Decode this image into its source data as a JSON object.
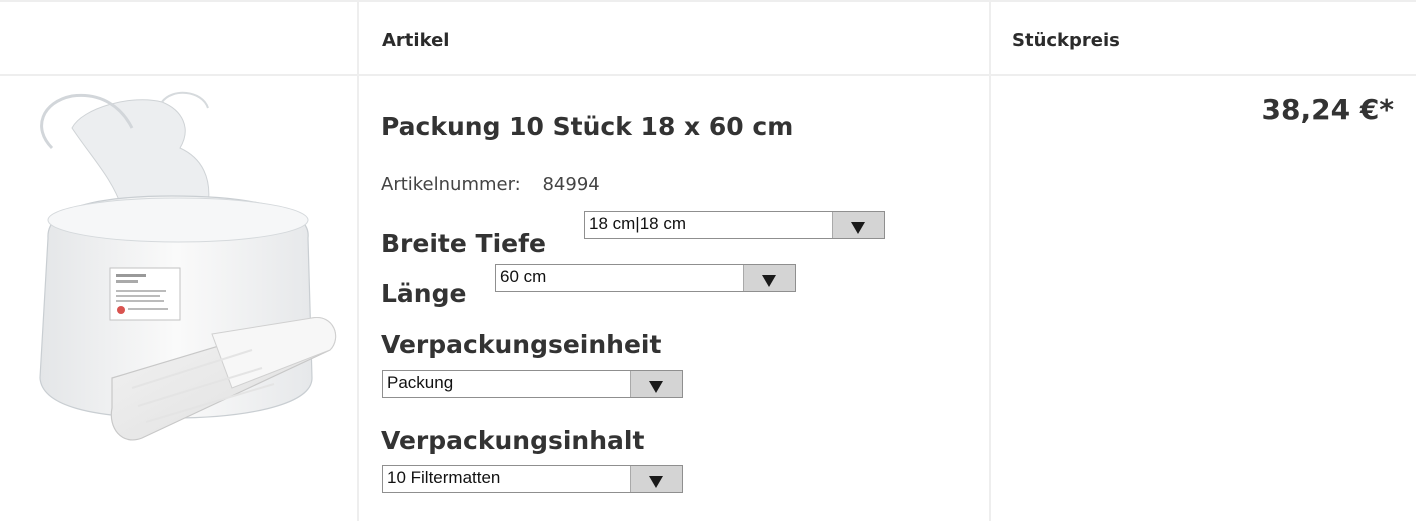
{
  "header": {
    "col_article": "Artikel",
    "col_unit_price": "Stückpreis"
  },
  "product": {
    "title": "Packung 10 Stück 18 x 60 cm",
    "article_number_label": "Artikelnummer:",
    "article_number": "84994",
    "price": "38,24 €*",
    "image_icon": "filter-mat-package-image"
  },
  "options": {
    "width_depth": {
      "label": "Breite Tiefe",
      "value": "18 cm|18 cm"
    },
    "length": {
      "label": "Länge",
      "value": "60 cm"
    },
    "packaging_unit": {
      "label": "Verpackungseinheit",
      "value": "Packung"
    },
    "packaging_content": {
      "label": "Verpackungsinhalt",
      "value": "10 Filtermatten"
    }
  }
}
